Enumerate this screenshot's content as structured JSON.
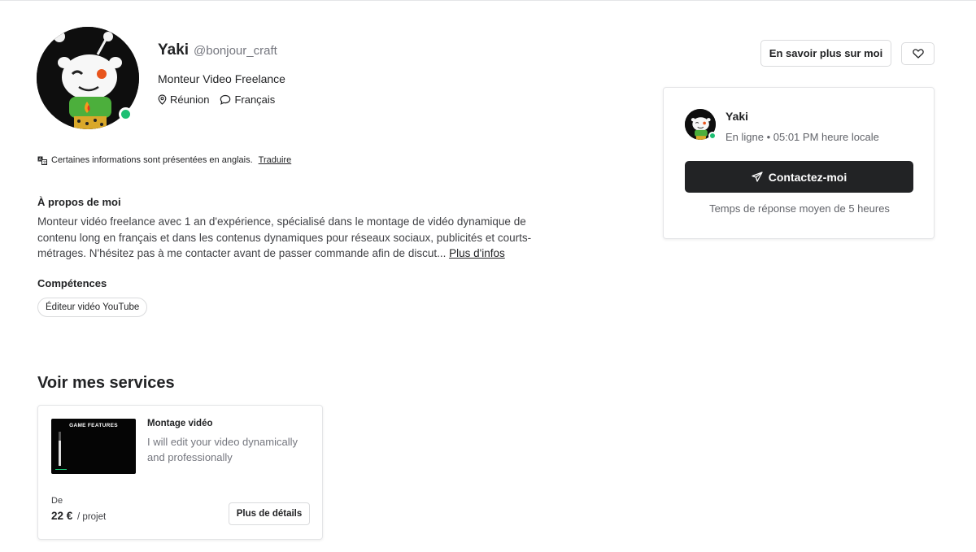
{
  "profile": {
    "name": "Yaki",
    "handle": "@bonjour_craft",
    "tagline": "Monteur Video Freelance",
    "location": "Réunion",
    "language": "Français"
  },
  "notice": {
    "text": "Certaines informations sont présentées en anglais.",
    "translate_link": "Traduire"
  },
  "about": {
    "title": "À propos de moi",
    "text": "Monteur vidéo freelance avec 1 an d'expérience, spécialisé dans le montage de vidéo dynamique de contenu long en français et dans les contenus dynamiques pour réseaux sociaux, publicités et courts-métrages. N'hésitez pas à me contacter avant de passer commande afin de discut...",
    "more_link": "Plus d'infos"
  },
  "skills": {
    "title": "Compétences",
    "items": [
      "Éditeur vidéo YouTube"
    ]
  },
  "services": {
    "title": "Voir mes services",
    "cards": [
      {
        "thumbnail_text": "GAME FEATURES",
        "thumbnail_progress": 0.75,
        "title": "Montage vidéo",
        "description": "I will edit your video dynamically and professionally",
        "price_label": "De",
        "price": "22 €",
        "price_unit": "/ projet",
        "details_button": "Plus de détails"
      }
    ]
  },
  "header_actions": {
    "learn_more": "En savoir plus sur moi",
    "favorite_icon": "heart-icon"
  },
  "contact_card": {
    "name": "Yaki",
    "status": "En ligne • 05:01 PM heure locale",
    "button": "Contactez-moi",
    "response_time": "Temps de réponse moyen de 5 heures"
  },
  "colors": {
    "online": "#1dbf73",
    "dark_button": "#222325",
    "border": "#dadbdd"
  }
}
